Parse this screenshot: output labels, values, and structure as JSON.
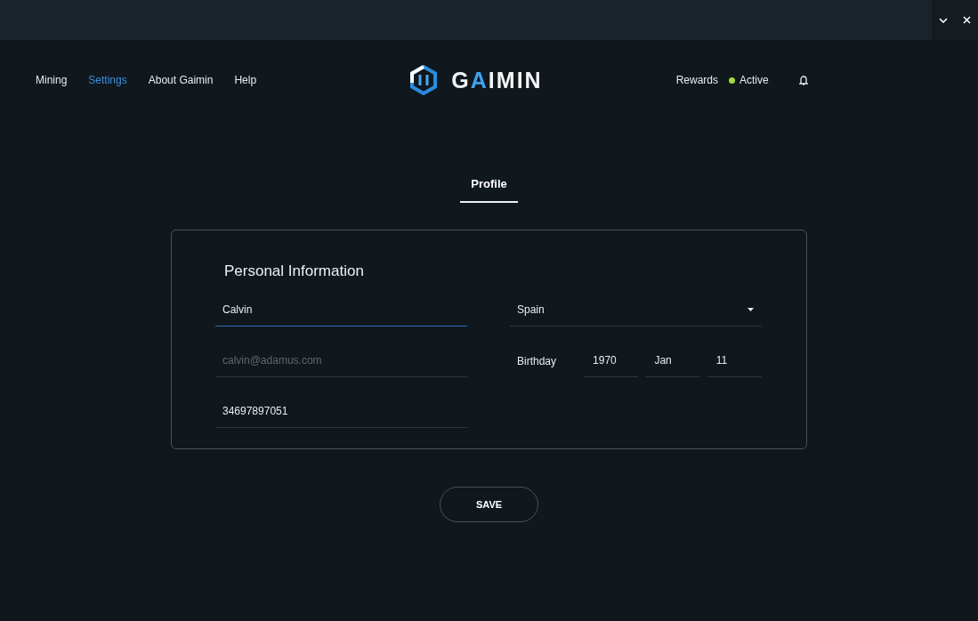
{
  "window_controls": [
    {
      "kind": "minimize"
    },
    {
      "kind": "close"
    }
  ],
  "nav": {
    "items": [
      {
        "label": "Mining",
        "selected": false
      },
      {
        "label": "Settings",
        "selected": true
      },
      {
        "label": "About Gaimin",
        "selected": false
      },
      {
        "label": "Help",
        "selected": false
      }
    ]
  },
  "logo": {
    "text": "GAIMIN"
  },
  "status": {
    "rewards": "Rewards",
    "state": "Active",
    "color": "#a6d93a"
  },
  "tabs": [
    {
      "label": "Profile",
      "selected": true
    }
  ],
  "form": {
    "title": "Personal Information",
    "name": {
      "value": "Calvin",
      "focused": true
    },
    "email": {
      "placeholder": "calvin@adamus.com"
    },
    "phone": {
      "value": "34697897051"
    },
    "country": {
      "value": "Spain"
    },
    "birthday": {
      "label": "Birthday",
      "year": "1970",
      "month": "Jan",
      "day": "11"
    }
  },
  "save": "SAVE"
}
